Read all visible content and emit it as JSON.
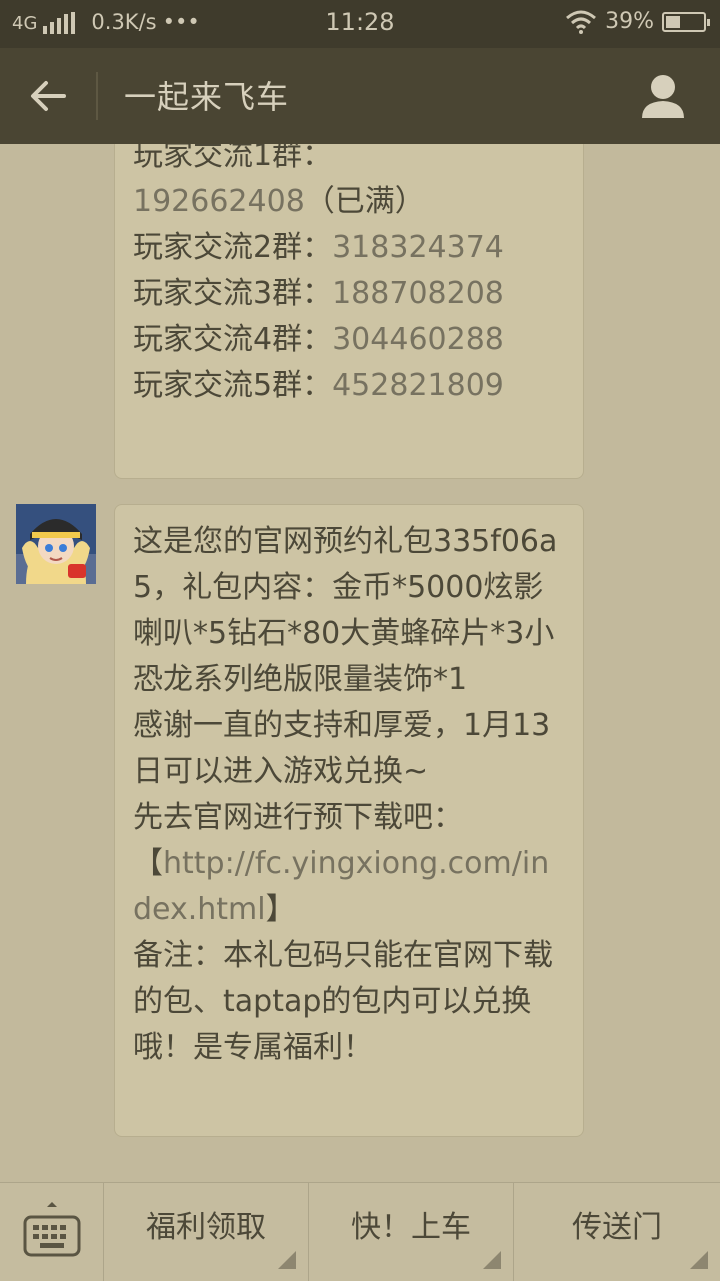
{
  "status_bar": {
    "network": "4G",
    "speed": "0.3K/s",
    "dots": "•••",
    "time": "11:28",
    "battery": "39%",
    "battery_level": 0.39
  },
  "header": {
    "title": "一起来飞车",
    "back_icon": "back-arrow-icon",
    "profile_icon": "person-icon"
  },
  "messages": [
    {
      "lines": [
        {
          "label": "玩家交流1群：",
          "value": ""
        },
        {
          "label": "",
          "value": "192662408",
          "suffix": "（已满）"
        },
        {
          "label": "玩家交流2群：",
          "value": "318324374"
        },
        {
          "label": "玩家交流3群：",
          "value": "188708208"
        },
        {
          "label": "玩家交流4群：",
          "value": "304460288"
        },
        {
          "label": "玩家交流5群：",
          "value": "452821809"
        }
      ]
    },
    {
      "sender_avatar": "game-character-avatar",
      "text_1": "这是您的官网预约礼包335f06a5，礼包内容：金币*5000炫影喇叭*5钻石*80大黄蜂碎片*3小恐龙系列绝版限量装饰*1",
      "text_2": "感谢一直的支持和厚爱，1月13日可以进入游戏兑换~",
      "text_3": "先去官网进行预下载吧：",
      "link_open": "【",
      "link": "http://fc.yingxiong.com/index.html",
      "link_close": "】",
      "text_4": "备注：本礼包码只能在官网下载的包、taptap的包内可以兑换哦！是专属福利！"
    }
  ],
  "bottom_menu": {
    "keyboard_icon": "keyboard-icon",
    "items": [
      {
        "label": "福利领取"
      },
      {
        "label": "快！上车"
      },
      {
        "label": "传送门"
      }
    ]
  },
  "colors": {
    "background": "#c2b99c",
    "header": "#4a4533",
    "bubble": "#cdc4a4",
    "text": "#4c4838",
    "number": "#777260"
  }
}
